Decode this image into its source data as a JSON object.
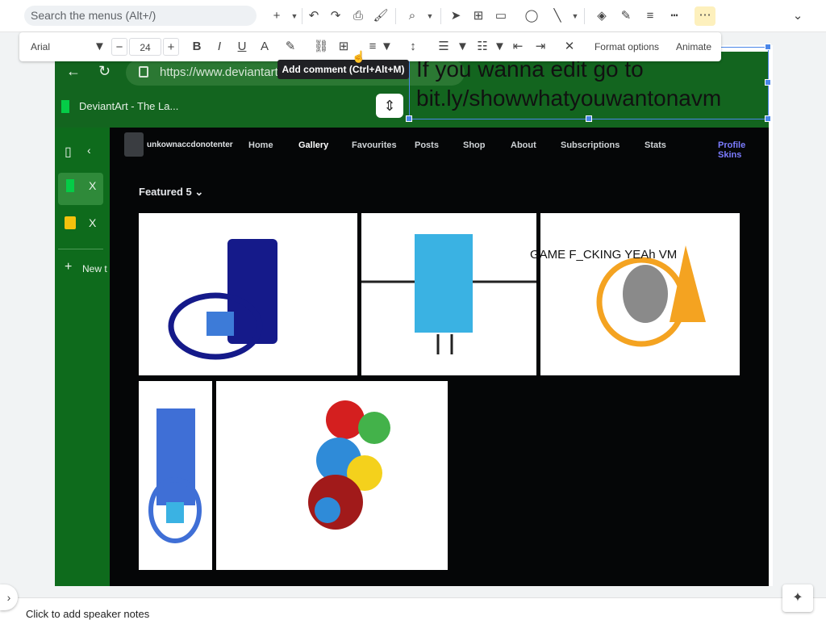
{
  "toolbar": {
    "search_placeholder": "Search the menus (Alt+/)",
    "icons": [
      "plus-icon",
      "undo-icon",
      "redo-icon",
      "print-icon",
      "paint-format-icon",
      "zoom-icon",
      "select-icon",
      "textbox-icon",
      "image-icon",
      "shape-icon",
      "line-icon",
      "fill-color-icon",
      "border-color-icon",
      "border-weight-icon",
      "border-dash-icon",
      "more-icon",
      "collapse-icon"
    ]
  },
  "format_bar": {
    "font": "Arial",
    "font_size": "24",
    "format_options": "Format options",
    "animate": "Animate"
  },
  "tooltip": "Add comment (Ctrl+Alt+M)",
  "screenshot": {
    "url": "https://www.deviantart.co",
    "tab_title": "DeviantArt - The La...",
    "sidebar_x1": "X",
    "sidebar_x2": "X",
    "new_tab": "New t",
    "username": "unkownaccdonotenter",
    "nav": [
      "Home",
      "Gallery",
      "Favourites",
      "Posts",
      "Shop",
      "About",
      "Subscriptions",
      "Stats",
      "Profile Skins"
    ],
    "featured": "Featured",
    "featured_count": "5"
  },
  "overlay_text_line1": "If you wanna edit go to",
  "overlay_text_line2": "bit.ly/showwhatyouwantonavm",
  "game_text": "GAME F_CKING YEAh VM",
  "bottom_text": "Click to add speaker notes",
  "colors": {
    "accent": "#4a86e8",
    "deviantart_green": "#13651f",
    "dark_bg": "#050607"
  }
}
